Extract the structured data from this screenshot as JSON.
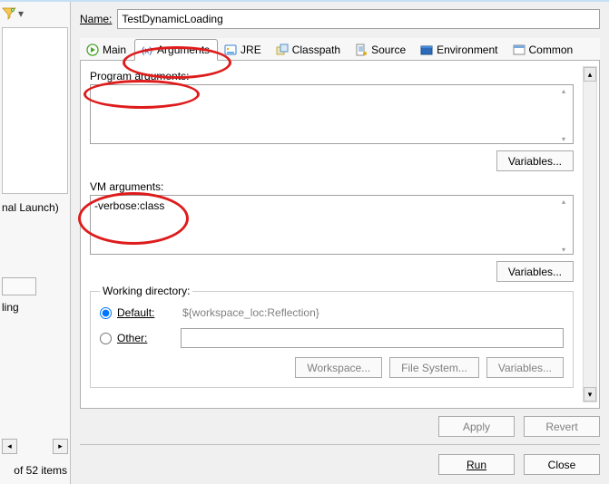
{
  "left": {
    "launch_text": "nal Launch)",
    "ling_text": "ling",
    "status": "of 52 items"
  },
  "name": {
    "label": "Name:",
    "value": "TestDynamicLoading"
  },
  "tabs": {
    "main": "Main",
    "arguments": "Arguments",
    "jre": "JRE",
    "classpath": "Classpath",
    "source": "Source",
    "environment": "Environment",
    "common": "Common"
  },
  "arguments": {
    "program_label_prefix": "Program ",
    "program_label_ul": "a",
    "program_label_suffix": "rguments:",
    "program_value": "",
    "variables_btn": "Variables...",
    "vm_label": "VM arguments:",
    "vm_value": "-verbose:class"
  },
  "workdir": {
    "title": "Working directory:",
    "default_label": "Default:",
    "default_value": "${workspace_loc:Reflection}",
    "other_label": "Other:",
    "workspace_btn": "Workspace...",
    "filesystem_btn": "File System...",
    "variables_btn": "Variables..."
  },
  "footer": {
    "apply": "Apply",
    "revert": "Revert",
    "run": "Run",
    "close": "Close"
  }
}
